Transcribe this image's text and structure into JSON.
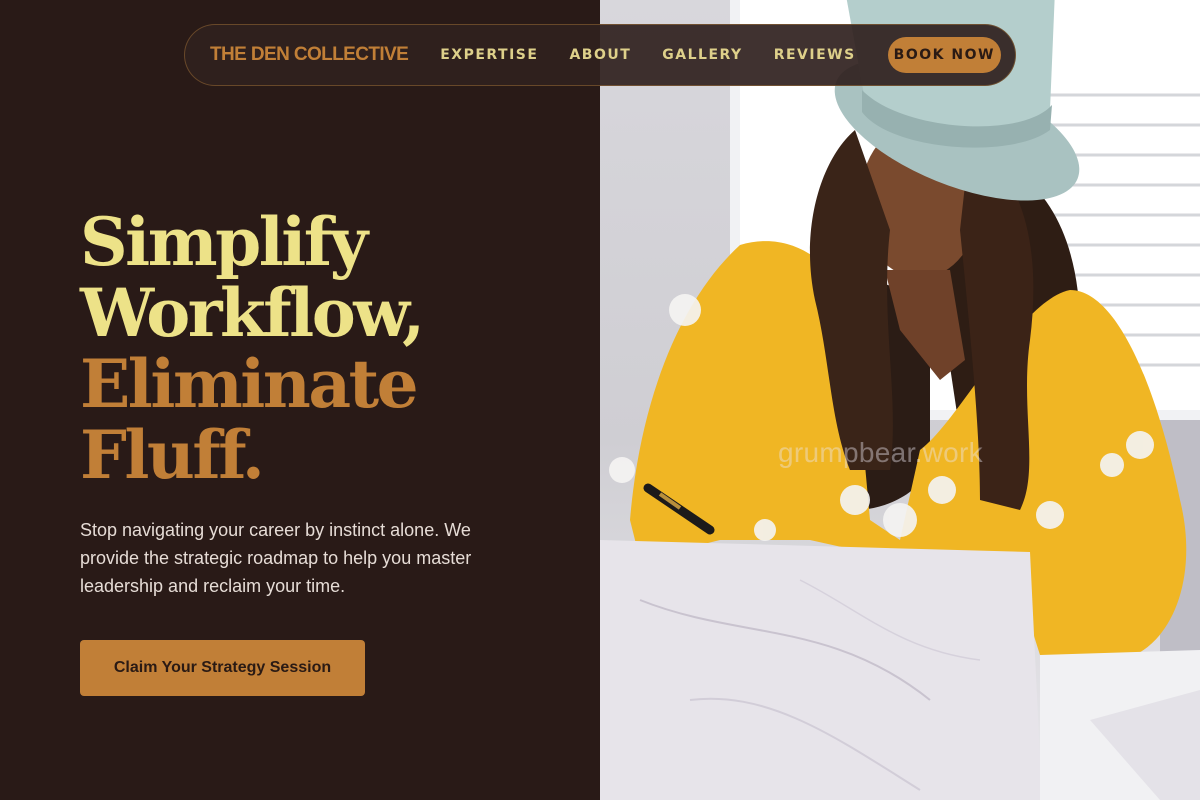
{
  "nav": {
    "brand": "THE DEN COLLECTIVE",
    "links": [
      "EXPERTISE",
      "ABOUT",
      "GALLERY",
      "REVIEWS"
    ],
    "cta": "BOOK NOW"
  },
  "hero": {
    "title_lines": [
      "Simplify",
      "Workflow,",
      "Eliminate",
      "Fluff."
    ],
    "subtitle": "Stop navigating your career by instinct alone. We provide the strategic roadmap to help you master leadership and reclaim your time.",
    "cta": "Claim Your Strategy Session"
  },
  "photo": {
    "watermark": "grumpbear.work"
  },
  "colors": {
    "background": "#291a17",
    "accent_gold": "#ede288",
    "accent_copper": "#c17f37",
    "body_text": "#e6dcd6"
  }
}
